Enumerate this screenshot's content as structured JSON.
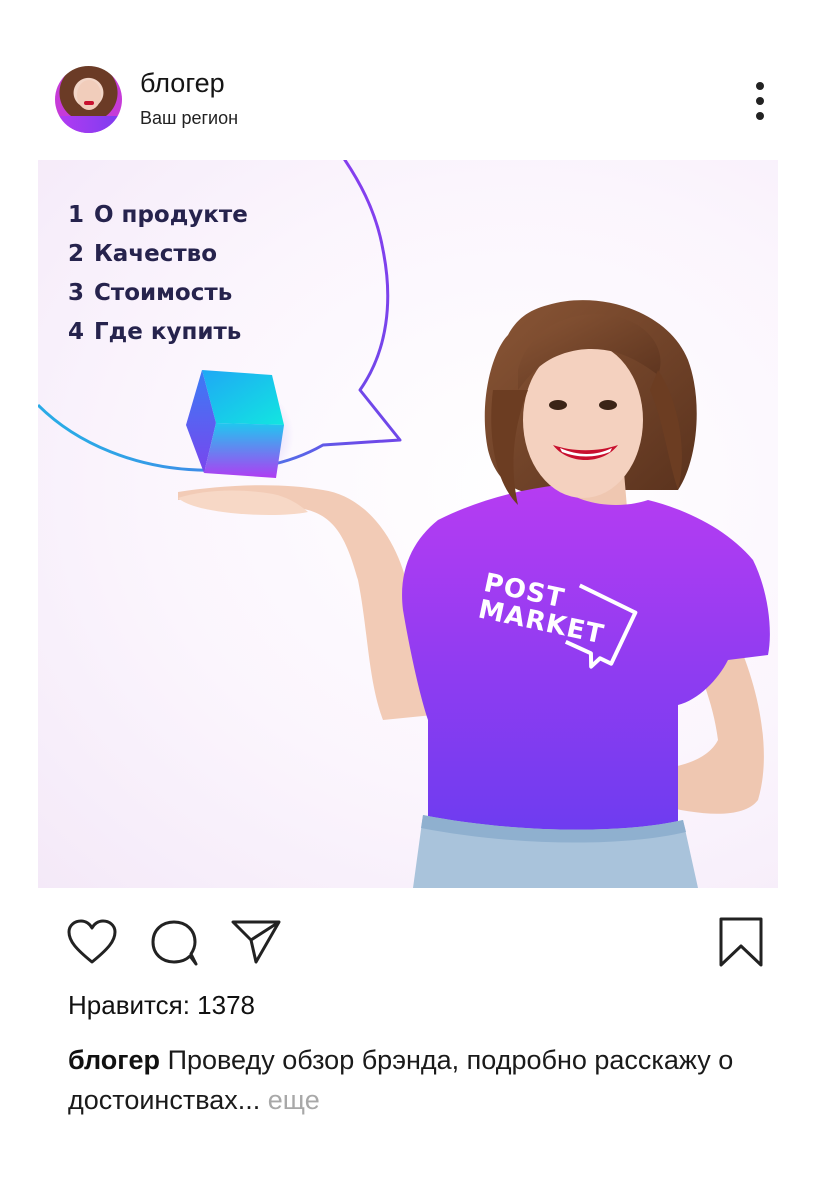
{
  "header": {
    "username": "блогер",
    "region": "Ваш регион",
    "more_icon": "vertical-ellipsis-icon"
  },
  "post": {
    "speech_bubble": {
      "items": [
        {
          "num": "1",
          "label": "О продукте"
        },
        {
          "num": "2",
          "label": "Качество"
        },
        {
          "num": "3",
          "label": "Стоимость"
        },
        {
          "num": "4",
          "label": "Где купить"
        }
      ]
    },
    "shirt_logo": {
      "line1": "POST",
      "line2": "MARKET"
    },
    "colors": {
      "accent_purple": "#b63cf2",
      "accent_violet": "#7a3cf0",
      "accent_cyan": "#19d3e6",
      "menu_text": "#26234d"
    }
  },
  "actions": {
    "like_icon": "heart-icon",
    "comment_icon": "comment-icon",
    "share_icon": "send-icon",
    "save_icon": "bookmark-icon"
  },
  "likes": {
    "label": "Нравится: 1378"
  },
  "caption": {
    "user": "блогер",
    "text": " Проведу обзор брэнда, подробно расскажу о достоинствах...",
    "more": " еще"
  }
}
